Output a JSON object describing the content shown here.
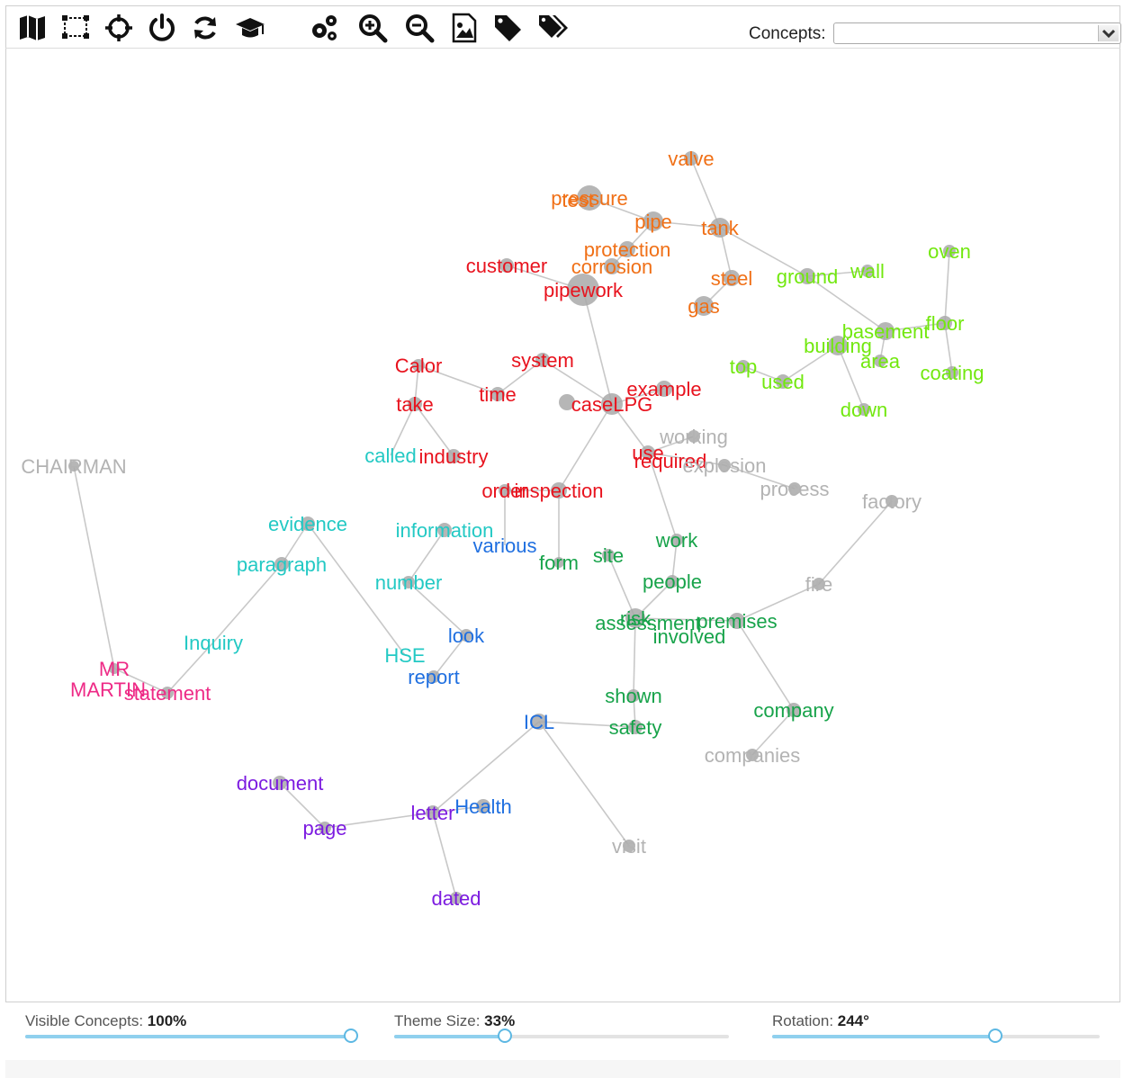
{
  "toolbar": {
    "icons": [
      "map-icon",
      "select-region-icon",
      "center-icon",
      "power-icon",
      "refresh-icon",
      "learn-icon",
      "settings-icon",
      "zoom-in-icon",
      "zoom-out-icon",
      "export-image-icon",
      "tag-icon",
      "tags-icon"
    ],
    "concepts_label": "Concepts:",
    "concepts_value": ""
  },
  "map": {
    "links": [
      [
        "valve",
        "tank"
      ],
      [
        "tank",
        "pipe"
      ],
      [
        "tank",
        "ground"
      ],
      [
        "pipe",
        "pressure"
      ],
      [
        "pipe",
        "protection"
      ],
      [
        "tank",
        "steel"
      ],
      [
        "steel",
        "gas"
      ],
      [
        "protection",
        "corrosion"
      ],
      [
        "pipework",
        "caseLPG"
      ],
      [
        "customer",
        "pipework"
      ],
      [
        "ground",
        "wall"
      ],
      [
        "ground",
        "basement"
      ],
      [
        "basement",
        "floor"
      ],
      [
        "floor",
        "oven"
      ],
      [
        "floor",
        "coating"
      ],
      [
        "basement",
        "area"
      ],
      [
        "building",
        "used"
      ],
      [
        "used",
        "top"
      ],
      [
        "building",
        "down"
      ],
      [
        "Calor",
        "time"
      ],
      [
        "time",
        "system"
      ],
      [
        "system",
        "caseLPG"
      ],
      [
        "caseLPG",
        "example"
      ],
      [
        "Calor",
        "take"
      ],
      [
        "take",
        "industry"
      ],
      [
        "take",
        "called"
      ],
      [
        "caseLPG",
        "inspection"
      ],
      [
        "inspection",
        "form"
      ],
      [
        "inspection",
        "order"
      ],
      [
        "order",
        "various"
      ],
      [
        "caseLPG",
        "use"
      ],
      [
        "use",
        "working"
      ],
      [
        "use",
        "explosion"
      ],
      [
        "explosion",
        "process"
      ],
      [
        "use",
        "work"
      ],
      [
        "work",
        "people"
      ],
      [
        "people",
        "risk"
      ],
      [
        "risk",
        "site"
      ],
      [
        "risk",
        "premises"
      ],
      [
        "premises",
        "fire"
      ],
      [
        "fire",
        "factory"
      ],
      [
        "premises",
        "company"
      ],
      [
        "company",
        "companies"
      ],
      [
        "risk",
        "shown"
      ],
      [
        "shown",
        "safety"
      ],
      [
        "safety",
        "ICL"
      ],
      [
        "ICL",
        "letter"
      ],
      [
        "ICL",
        "visit"
      ],
      [
        "letter",
        "Health"
      ],
      [
        "letter",
        "page"
      ],
      [
        "page",
        "document"
      ],
      [
        "letter",
        "dated"
      ],
      [
        "information",
        "number"
      ],
      [
        "number",
        "look"
      ],
      [
        "look",
        "report"
      ],
      [
        "evidence",
        "paragraph"
      ],
      [
        "evidence",
        "HSE"
      ],
      [
        "paragraph",
        "Inquiry"
      ],
      [
        "Inquiry",
        "statement"
      ],
      [
        "statement",
        "MR MARTIN"
      ],
      [
        "MR MARTIN",
        "CHAIRMAN"
      ]
    ],
    "nodes": [
      {
        "id": "valve",
        "label": "valve",
        "color": "#f07017",
        "r": 8
      },
      {
        "id": "pressure",
        "label": "pressure",
        "color": "#f07017",
        "r": 14
      },
      {
        "id": "test",
        "label": "test",
        "color": "#f07017",
        "r": 0
      },
      {
        "id": "pipe",
        "label": "pipe",
        "color": "#f07017",
        "r": 11
      },
      {
        "id": "tank",
        "label": "tank",
        "color": "#f07017",
        "r": 11
      },
      {
        "id": "protection",
        "label": "protection",
        "color": "#f07017",
        "r": 9
      },
      {
        "id": "corrosion",
        "label": "corrosion",
        "color": "#f07017",
        "r": 9
      },
      {
        "id": "steel",
        "label": "steel",
        "color": "#f07017",
        "r": 9
      },
      {
        "id": "gas",
        "label": "gas",
        "color": "#f07017",
        "r": 11
      },
      {
        "id": "customer",
        "label": "customer",
        "color": "#e8131e",
        "r": 8
      },
      {
        "id": "pipework",
        "label": "pipework",
        "color": "#e8131e",
        "r": 18
      },
      {
        "id": "Calor",
        "label": "Calor",
        "color": "#e8131e",
        "r": 7
      },
      {
        "id": "system",
        "label": "system",
        "color": "#e8131e",
        "r": 8
      },
      {
        "id": "time",
        "label": "time",
        "color": "#e8131e",
        "r": 8
      },
      {
        "id": "take",
        "label": "take",
        "color": "#e8131e",
        "r": 8
      },
      {
        "id": "caseLPG",
        "label": "caseLPG",
        "color": "#e8131e",
        "r": 12
      },
      {
        "id": "case",
        "label": "",
        "color": "#e8131e",
        "r": 9
      },
      {
        "id": "example",
        "label": "example",
        "color": "#e8131e",
        "r": 9
      },
      {
        "id": "industry",
        "label": "industry",
        "color": "#e8131e",
        "r": 8
      },
      {
        "id": "use",
        "label": "use",
        "color": "#e8131e",
        "r": 8
      },
      {
        "id": "required",
        "label": "required",
        "color": "#e8131e",
        "r": 0
      },
      {
        "id": "order",
        "label": "order",
        "color": "#e8131e",
        "r": 7
      },
      {
        "id": "inspection",
        "label": "inspection",
        "color": "#e8131e",
        "r": 9
      },
      {
        "id": "ground",
        "label": "ground",
        "color": "#72e80f",
        "r": 9
      },
      {
        "id": "wall",
        "label": "wall",
        "color": "#72e80f",
        "r": 7
      },
      {
        "id": "oven",
        "label": "oven",
        "color": "#72e80f",
        "r": 7
      },
      {
        "id": "floor",
        "label": "floor",
        "color": "#72e80f",
        "r": 8
      },
      {
        "id": "basement",
        "label": "basement",
        "color": "#72e80f",
        "r": 10
      },
      {
        "id": "building",
        "label": "building",
        "color": "#72e80f",
        "r": 11
      },
      {
        "id": "area",
        "label": "area",
        "color": "#72e80f",
        "r": 7
      },
      {
        "id": "coating",
        "label": "coating",
        "color": "#72e80f",
        "r": 7
      },
      {
        "id": "top",
        "label": "top",
        "color": "#72e80f",
        "r": 7
      },
      {
        "id": "used",
        "label": "used",
        "color": "#72e80f",
        "r": 8
      },
      {
        "id": "down",
        "label": "down",
        "color": "#72e80f",
        "r": 7
      },
      {
        "id": "working",
        "label": "working",
        "color": "#b3b3b3",
        "r": 7
      },
      {
        "id": "explosion",
        "label": "explosion",
        "color": "#b3b3b3",
        "r": 7
      },
      {
        "id": "process",
        "label": "process",
        "color": "#b3b3b3",
        "r": 7
      },
      {
        "id": "factory",
        "label": "factory",
        "color": "#b3b3b3",
        "r": 7
      },
      {
        "id": "fire",
        "label": "fire",
        "color": "#b3b3b3",
        "r": 7
      },
      {
        "id": "companies",
        "label": "companies",
        "color": "#b3b3b3",
        "r": 7
      },
      {
        "id": "visit",
        "label": "visit",
        "color": "#b3b3b3",
        "r": 7
      },
      {
        "id": "CHAIRMAN",
        "label": "CHAIRMAN",
        "color": "#b3b3b3",
        "r": 6
      },
      {
        "id": "work",
        "label": "work",
        "color": "#17a34a",
        "r": 7
      },
      {
        "id": "site",
        "label": "site",
        "color": "#17a34a",
        "r": 7
      },
      {
        "id": "form",
        "label": "form",
        "color": "#17a34a",
        "r": 6
      },
      {
        "id": "people",
        "label": "people",
        "color": "#17a34a",
        "r": 7
      },
      {
        "id": "risk",
        "label": "risk",
        "color": "#17a34a",
        "r": 11
      },
      {
        "id": "assessment",
        "label": "assessment",
        "color": "#17a34a",
        "r": 0
      },
      {
        "id": "involved",
        "label": "involved",
        "color": "#17a34a",
        "r": 0
      },
      {
        "id": "premises",
        "label": "premises",
        "color": "#17a34a",
        "r": 9
      },
      {
        "id": "shown",
        "label": "shown",
        "color": "#17a34a",
        "r": 7
      },
      {
        "id": "safety",
        "label": "safety",
        "color": "#17a34a",
        "r": 8
      },
      {
        "id": "company",
        "label": "company",
        "color": "#17a34a",
        "r": 8
      },
      {
        "id": "evidence",
        "label": "evidence",
        "color": "#23c9c4",
        "r": 8
      },
      {
        "id": "information",
        "label": "information",
        "color": "#23c9c4",
        "r": 8
      },
      {
        "id": "paragraph",
        "label": "paragraph",
        "color": "#23c9c4",
        "r": 8
      },
      {
        "id": "number",
        "label": "number",
        "color": "#23c9c4",
        "r": 7
      },
      {
        "id": "Inquiry",
        "label": "Inquiry",
        "color": "#23c9c4",
        "r": 0
      },
      {
        "id": "HSE",
        "label": "HSE",
        "color": "#23c9c4",
        "r": 0
      },
      {
        "id": "called",
        "label": "called",
        "color": "#23c9c4",
        "r": 0
      },
      {
        "id": "various",
        "label": "various",
        "color": "#1f6fe0",
        "r": 0
      },
      {
        "id": "look",
        "label": "look",
        "color": "#1f6fe0",
        "r": 7
      },
      {
        "id": "report",
        "label": "report",
        "color": "#1f6fe0",
        "r": 7
      },
      {
        "id": "ICL",
        "label": "ICL",
        "color": "#1f6fe0",
        "r": 9
      },
      {
        "id": "Health",
        "label": "Health",
        "color": "#1f6fe0",
        "r": 8
      },
      {
        "id": "MR MARTIN",
        "label": "MR",
        "color": "#ee2a86",
        "r": 6
      },
      {
        "id": "MARTIN",
        "label": "MARTIN",
        "color": "#ee2a86",
        "r": 0
      },
      {
        "id": "statement",
        "label": "statement",
        "color": "#ee2a86",
        "r": 7
      },
      {
        "id": "document",
        "label": "document",
        "color": "#7c1be0",
        "r": 8
      },
      {
        "id": "page",
        "label": "page",
        "color": "#7c1be0",
        "r": 7
      },
      {
        "id": "letter",
        "label": "letter",
        "color": "#7c1be0",
        "r": 8
      },
      {
        "id": "dated",
        "label": "dated",
        "color": "#7c1be0",
        "r": 7
      }
    ]
  },
  "controls": {
    "visible_label": "Visible Concepts:",
    "visible_value": "100%",
    "visible_fraction": 1.0,
    "theme_label": "Theme Size:",
    "theme_value": "33%",
    "theme_fraction": 0.33,
    "rotation_label": "Rotation:",
    "rotation_value": "244°",
    "rotation_fraction": 0.68
  }
}
